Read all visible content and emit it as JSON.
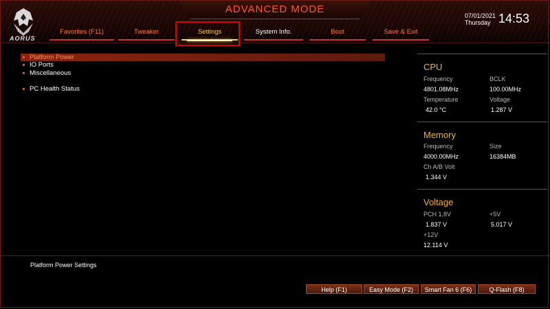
{
  "header": {
    "title": "ADVANCED MODE",
    "logo_text": "AORUS"
  },
  "tabs": [
    {
      "label": "Favorites (F11)"
    },
    {
      "label": "Tweaker"
    },
    {
      "label": "Settings"
    },
    {
      "label": "System Info."
    },
    {
      "label": "Boot"
    },
    {
      "label": "Save & Exit"
    }
  ],
  "active_tab": "Settings",
  "datetime": {
    "date": "07/01/2021",
    "day": "Thursday",
    "time": "14:53"
  },
  "menu": {
    "items": [
      {
        "label": "Platform Power",
        "selected": true
      },
      {
        "label": "IO Ports",
        "selected": false
      },
      {
        "label": "Miscellaneous",
        "selected": false
      },
      {
        "label": "PC Health Status",
        "selected": false
      }
    ]
  },
  "status": {
    "cpu": {
      "title": "CPU",
      "frequency_label": "Frequency",
      "frequency": "4801.08MHz",
      "bclk_label": "BCLK",
      "bclk": "100.00MHz",
      "temperature_label": "Temperature",
      "temperature": "42.0 °C",
      "voltage_label": "Voltage",
      "voltage": "1.287 V"
    },
    "memory": {
      "title": "Memory",
      "frequency_label": "Frequency",
      "frequency": "4000.00MHz",
      "size_label": "Size",
      "size": "16384MB",
      "volt_label": "Ch A/B Volt",
      "volt": "1.344 V"
    },
    "voltage": {
      "title": "Voltage",
      "pch_label": "PCH 1.8V",
      "pch": "1.837 V",
      "p5v_label": "+5V",
      "p5v": "5.017 V",
      "p12v_label": "+12V",
      "p12v": "12.114 V"
    }
  },
  "help_text": "Platform Power Settings",
  "footer": {
    "help": "Help (F1)",
    "easy_mode": "Easy Mode (F2)",
    "smart_fan": "Smart Fan 6 (F6)",
    "qflash": "Q-Flash (F8)"
  },
  "colors": {
    "accent": "#ff5a2a",
    "active_tab": "#ffd040",
    "section_title": "#f3b33a",
    "highlight_box": "#e00000"
  }
}
